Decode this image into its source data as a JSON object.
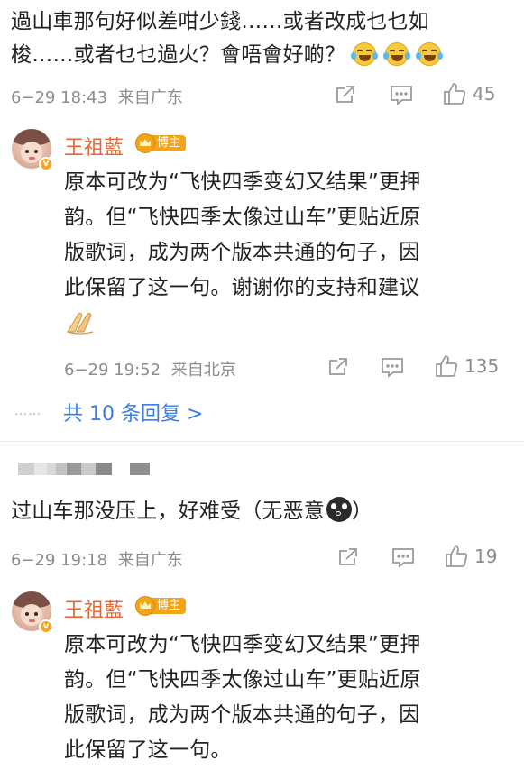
{
  "comment1": {
    "text_line1": "過山車那句好似差咁少錢……或者改成乜乜如",
    "text_line2": "梭……或者乜乜過火？會唔會好啲？",
    "emojis": [
      "laughing-crying-icon",
      "laughing-crying-icon",
      "laughing-crying-icon"
    ],
    "timestamp": "6−29 18:43",
    "location": "来自广东",
    "like_count": "45"
  },
  "reply1": {
    "username": "王祖藍",
    "host_badge": "博主",
    "verified_mark": "v",
    "lines": [
      "原本可改为“飞快四季变幻又结果”更押",
      "韵。但“飞快四季太像过山车”更贴近原",
      "版歌词，成为两个版本共通的句子，因",
      "此保留了这一句。谢谢你的支持和建议"
    ],
    "trailing_emoji": "clapping-hands-icon",
    "timestamp": "6−29 19:52",
    "location": "来自北京",
    "like_count": "135",
    "dots": "……",
    "reply_count_label": "共 10 条回复 >"
  },
  "comment2": {
    "text": "过山车那没压上，好难受（无恶意",
    "text_end": "）",
    "emoji": "crying-face-icon",
    "timestamp": "6−29 19:18",
    "location": "来自广东",
    "like_count": "19"
  },
  "reply2": {
    "username": "王祖藍",
    "host_badge": "博主",
    "verified_mark": "v",
    "lines": [
      "原本可改为“飞快四季变幻又结果”更押",
      "韵。但“飞快四季太像过山车”更贴近原",
      "版歌词，成为两个版本共通的句子，因",
      "此保留了这一句。"
    ]
  },
  "colors": {
    "accent_username": "#e8672f",
    "link_blue": "#3b7de0",
    "meta_gray": "#8c8c8c",
    "badge_gold": "#f2a51a"
  }
}
